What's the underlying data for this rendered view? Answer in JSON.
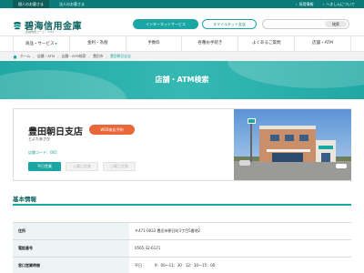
{
  "colors": {
    "accent": "#1aa6a2",
    "topbar": "#0a7b78",
    "brand": "#0a5f5d",
    "reserve": "#e9683a"
  },
  "topbar": {
    "tabs": [
      "個人のお客さま",
      "法人のお客さま"
    ],
    "links": [
      "採用情報",
      "へきしんについて"
    ]
  },
  "header": {
    "logo_text": "碧海信用金庫",
    "logo_sub": "金融機関コード：1551",
    "internet_service": "インターネットサービス",
    "smartphone_app": "スマイルネット支店",
    "search_placeholder": "",
    "search_button": "検索"
  },
  "gnav": [
    "商品・サービス",
    "金利・為替",
    "手数料",
    "各種お手続き",
    "よくあるご質問",
    "店舗・ATM"
  ],
  "breadcrumb": {
    "home": "ホーム",
    "items": [
      "店舗・ATM",
      "店舗・ATM検索",
      "豊田市"
    ],
    "current": "豊田朝日支店"
  },
  "hero": {
    "title": "店舗・ATM検索"
  },
  "branch": {
    "name": "豊田朝日支店",
    "kana": "とよたあさひ",
    "web_reserve": "WEB来店予約",
    "store_code": "店舗コード：065",
    "statuses": [
      "平日営業",
      "土曜日営業",
      "日曜日営業"
    ]
  },
  "basic_info": {
    "title": "基本情報",
    "rows": [
      {
        "label": "住所",
        "value": "〒471-0032 豊田市朝日町3丁目5番地2"
      },
      {
        "label": "電話番号",
        "value": "0565-32-6171"
      },
      {
        "label": "窓口営業時間",
        "day": "平日",
        "hours": "9：00～11：30　12：30～15：00"
      }
    ]
  }
}
